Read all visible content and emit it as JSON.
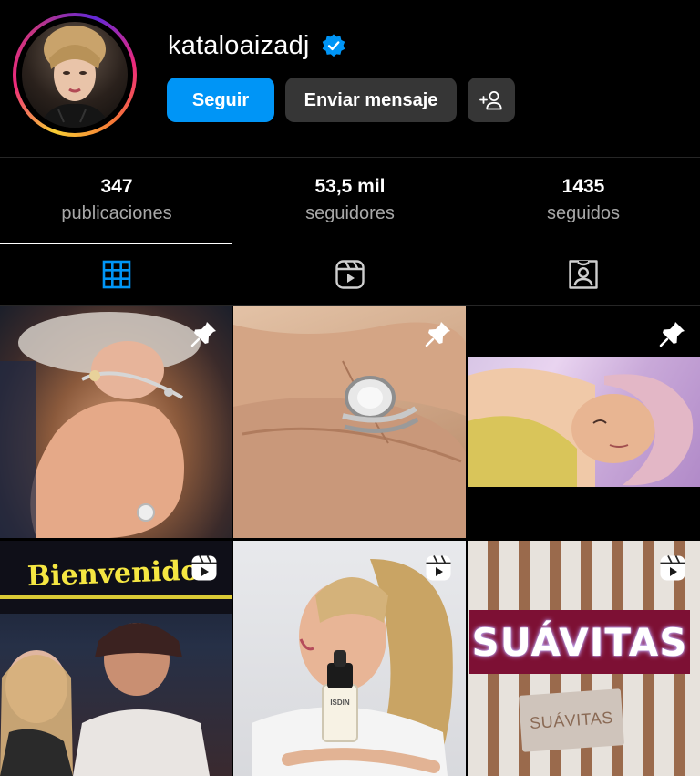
{
  "profile": {
    "username": "kataloaizadj",
    "verified": true,
    "verified_color": "#0095f6",
    "follow_label": "Seguir",
    "message_label": "Enviar mensaje",
    "suggest_icon": "add-person-icon"
  },
  "stats": [
    {
      "value": "347",
      "label": "publicaciones"
    },
    {
      "value": "53,5 mil",
      "label": "seguidores"
    },
    {
      "value": "1435",
      "label": "seguidos"
    }
  ],
  "tabs": [
    {
      "icon": "grid-icon",
      "active": true,
      "color": "#0095f6"
    },
    {
      "icon": "reels-icon",
      "active": false
    },
    {
      "icon": "tagged-icon",
      "active": false
    }
  ],
  "posts": [
    {
      "badge": "pin-icon",
      "description": "hand-with-ring"
    },
    {
      "badge": "pin-icon",
      "description": "ring-closeup"
    },
    {
      "badge": "pin-icon",
      "description": "face-mask"
    },
    {
      "badge": "reel-icon",
      "sign_text": "Bienvenidos"
    },
    {
      "badge": "reel-icon",
      "product_text": "ISDIN"
    },
    {
      "badge": "reel-icon",
      "sign_text": "SUÁVITAS",
      "card_text": "SUÁVITAS"
    }
  ],
  "colors": {
    "background": "#000000",
    "primary_button": "#0095f6",
    "secondary_button": "#363636",
    "muted_text": "#a8a8a8",
    "divider": "#262626"
  }
}
